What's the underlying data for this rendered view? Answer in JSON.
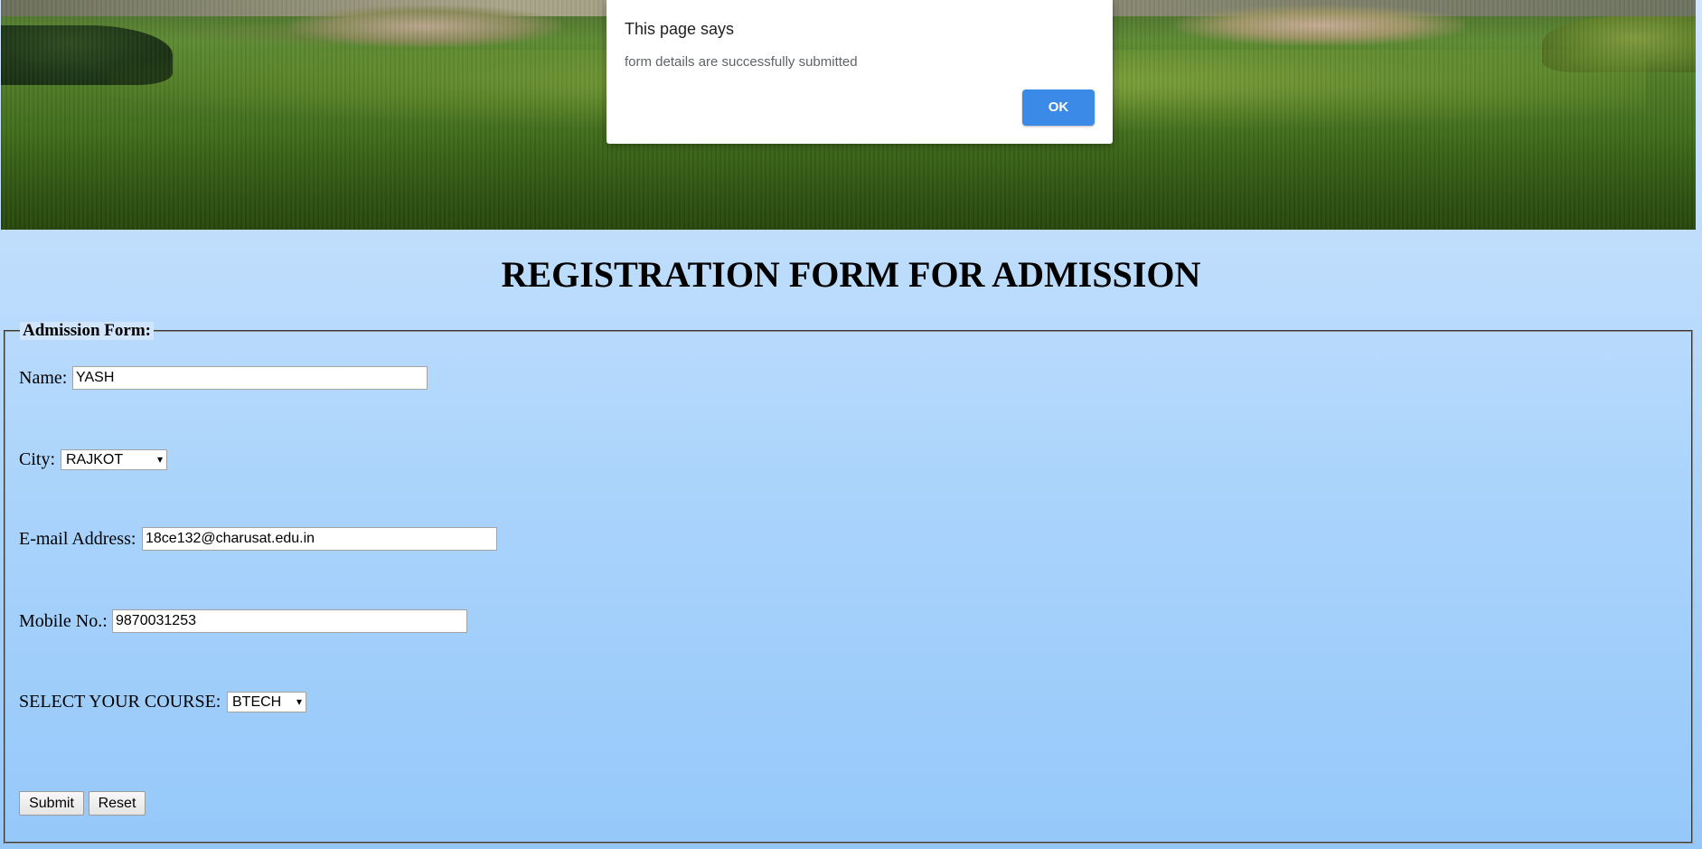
{
  "header": {
    "title": "REGISTRATION FORM FOR ADMISSION"
  },
  "form": {
    "legend": "Admission Form:",
    "name": {
      "label": "Name:",
      "value": "YASH"
    },
    "city": {
      "label": "City:",
      "selected": "RAJKOT"
    },
    "email": {
      "label": "E-mail Address:",
      "value": "18ce132@charusat.edu.in"
    },
    "mobile": {
      "label": "Mobile No.:",
      "value": "9870031253"
    },
    "course": {
      "label": "SELECT YOUR COURSE:",
      "selected": "BTECH"
    },
    "submit_label": "Submit",
    "reset_label": "Reset"
  },
  "alert": {
    "title": "This page says",
    "message": "form details are successfully submitted",
    "ok_label": "OK",
    "ok_color": "#3b8ae8"
  },
  "icons": {
    "dropdown": "▾"
  }
}
